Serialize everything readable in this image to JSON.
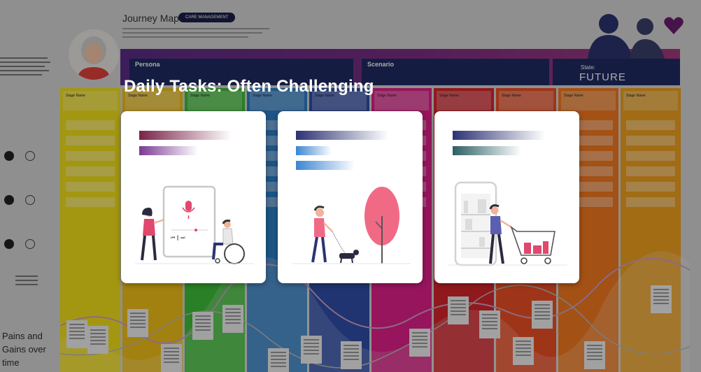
{
  "overlay": {
    "title": "Daily Tasks: Often Challenging"
  },
  "background": {
    "title": "Journey Map",
    "badge": "CARE MANAGEMENT",
    "persona_label": "Persona",
    "scenario_label": "Scenario",
    "state_label": "State:",
    "state_value": "FUTURE",
    "stage_name": "Stage Name",
    "pains_gains": "Pains and Gains over time",
    "stage_colors": [
      "#f4e11a",
      "#f2c01a",
      "#3fbf3a",
      "#2e7fc8",
      "#2f4ea8",
      "#e0208a",
      "#d7262c",
      "#ee4f25",
      "#f37a20",
      "#f0a21f"
    ]
  },
  "cards": [
    {
      "illustration": "voice-assistant-wheelchair-illustration",
      "bars": [
        {
          "fill": 1.0,
          "color": "#7a2346"
        },
        {
          "fill": 0.64,
          "color": "#7a3a94"
        }
      ]
    },
    {
      "illustration": "dog-walk-illustration",
      "bars": [
        {
          "fill": 1.0,
          "color": "#2c3373"
        },
        {
          "fill": 0.39,
          "color": "#3b86d0"
        },
        {
          "fill": 0.64,
          "color": "#3b86d0"
        }
      ]
    },
    {
      "illustration": "online-shopping-cart-illustration",
      "bars": [
        {
          "fill": 1.0,
          "color": "#2c3373"
        },
        {
          "fill": 0.74,
          "color": "#2c5f63"
        }
      ]
    }
  ]
}
